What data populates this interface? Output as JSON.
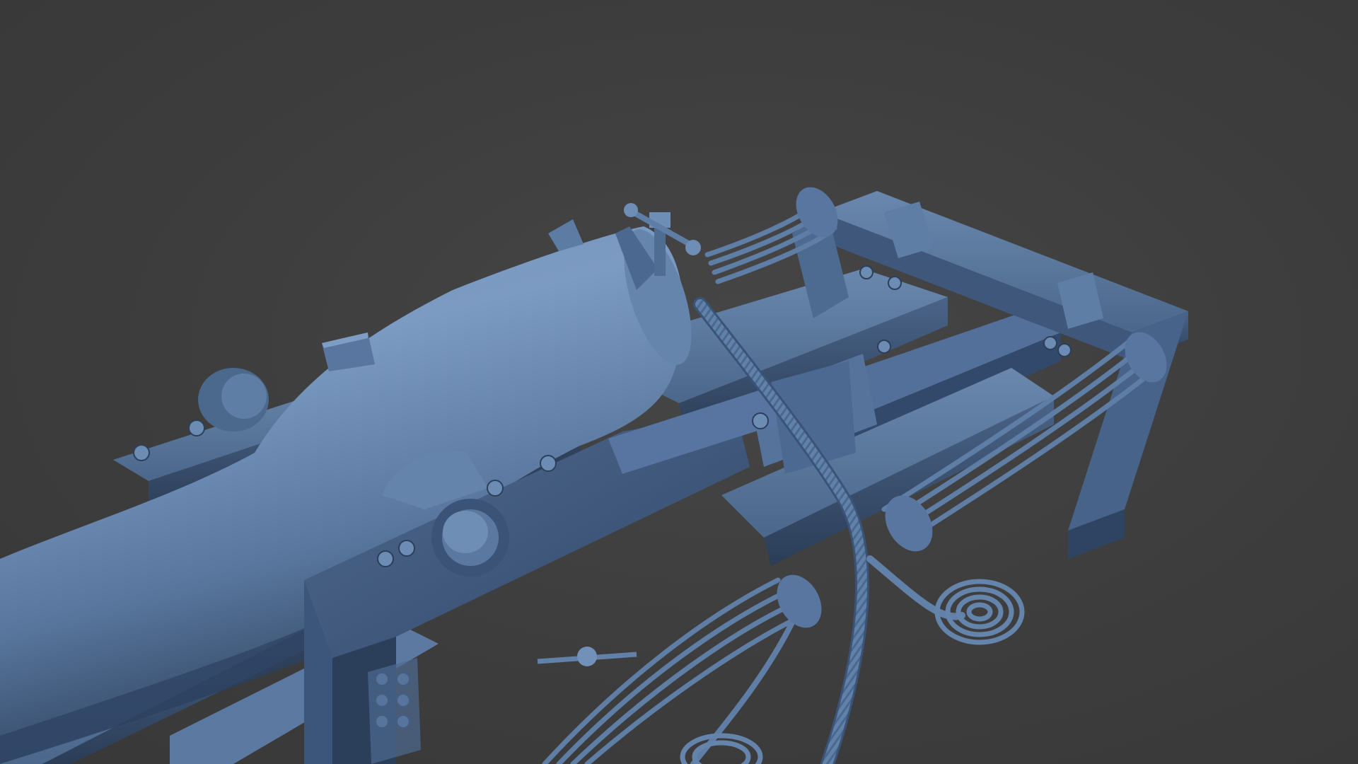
{
  "scene": {
    "subject": "cannon-on-carriage-sculpt",
    "colors": {
      "background": "#3f3f3f",
      "clay_base": "#4f6d93",
      "clay_light": "#7e9cc3",
      "clay_mid": "#5b7aa2",
      "clay_dark": "#2c3f5a",
      "clay_shadow": "#22324a"
    }
  }
}
